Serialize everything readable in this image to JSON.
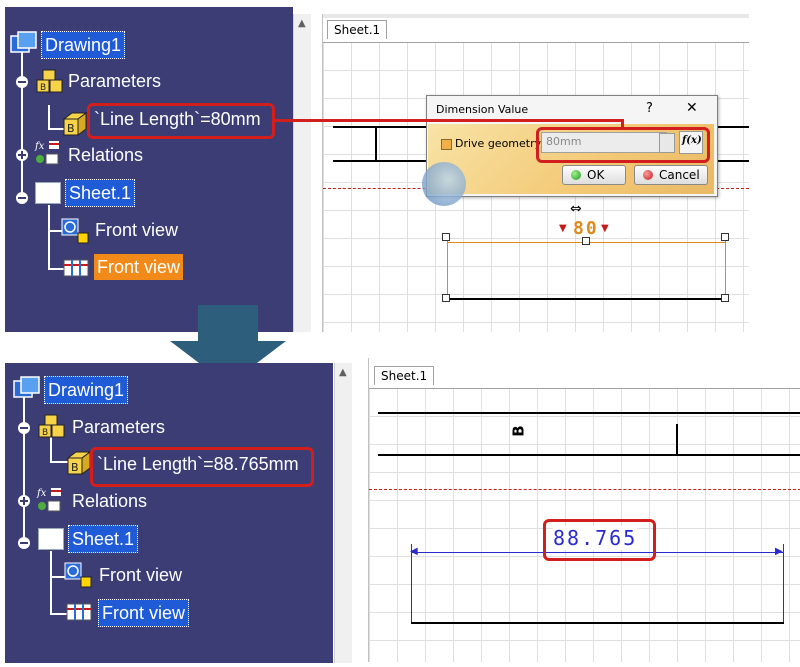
{
  "top": {
    "tree": {
      "root": "Drawing1",
      "parameters": "Parameters",
      "param_value": "`Line Length`=80mm",
      "relations": "Relations",
      "sheet": "Sheet.1",
      "front_view_1": "Front view",
      "front_view_2": "Front view"
    },
    "tab": "Sheet.1",
    "dimension_value": "80",
    "dialog": {
      "title": "Dimension Value",
      "help": "?",
      "close": "✕",
      "checkbox_label": "Drive geometry",
      "input_value": "80mm",
      "fx": "f(x)",
      "ok": "OK",
      "cancel": "Cancel"
    }
  },
  "bottom": {
    "tree": {
      "root": "Drawing1",
      "parameters": "Parameters",
      "param_value": "`Line Length`=88.765mm",
      "relations": "Relations",
      "sheet": "Sheet.1",
      "front_view_1": "Front view",
      "front_view_2": "Front view"
    },
    "tab": "Sheet.1",
    "letter": "B",
    "dimension_value": "88.765"
  },
  "colors": {
    "tree_bg": "#3c3d75",
    "highlight_red": "#d31e1e",
    "selection_blue": "#1f5bd6",
    "selection_orange": "#f28a1a",
    "dimension_orange": "#e08a1e",
    "dimension_blue": "#2a2ad0",
    "arrow_teal": "#2d5f7c"
  },
  "icons": {
    "drawing": "drawing-icon",
    "parameters": "parameters-icon",
    "parameter": "parameter-formula-icon",
    "relations": "relations-fx-icon",
    "sheet": "sheet-icon",
    "view": "front-view-icon",
    "arrow": "down-arrow-icon"
  }
}
